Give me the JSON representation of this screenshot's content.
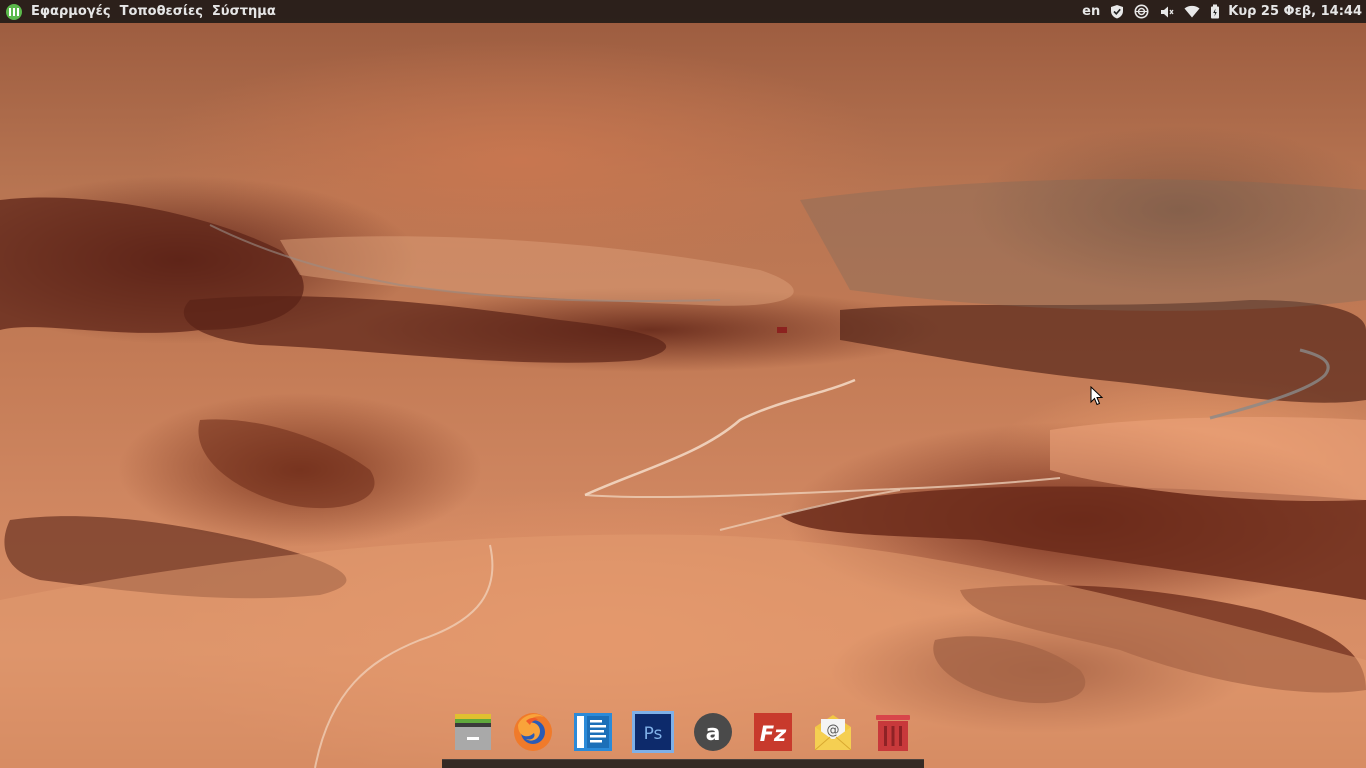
{
  "top_panel": {
    "menus": [
      "Εφαρμογές",
      "Τοποθεσίες",
      "Σύστημα"
    ],
    "tray": {
      "keyboard_layout": "en",
      "icons": [
        "shield-icon",
        "network-globe-icon",
        "volume-icon",
        "wifi-icon",
        "battery-icon"
      ],
      "clock": "Κυρ 25 Φεβ, 14:44"
    }
  },
  "dock": {
    "items": [
      {
        "name": "files-app",
        "icon": "file-manager-icon"
      },
      {
        "name": "firefox-app",
        "icon": "firefox-icon"
      },
      {
        "name": "text-editor-app",
        "icon": "text-editor-icon"
      },
      {
        "name": "photoshop-app",
        "icon": "photoshop-icon",
        "label": "Ps"
      },
      {
        "name": "amazon-app",
        "icon": "amazon-icon",
        "label": "a"
      },
      {
        "name": "filezilla-app",
        "icon": "filezilla-icon",
        "label": "Fz"
      },
      {
        "name": "mail-app",
        "icon": "mail-icon",
        "label": "@"
      },
      {
        "name": "trash",
        "icon": "trash-icon"
      }
    ]
  },
  "colors": {
    "panel_bg": "#141414",
    "menu_green": "#5bb94b",
    "ps_blue": "#0d2a6b",
    "filezilla_red": "#c83a2c",
    "trash_red": "#c8393b"
  }
}
